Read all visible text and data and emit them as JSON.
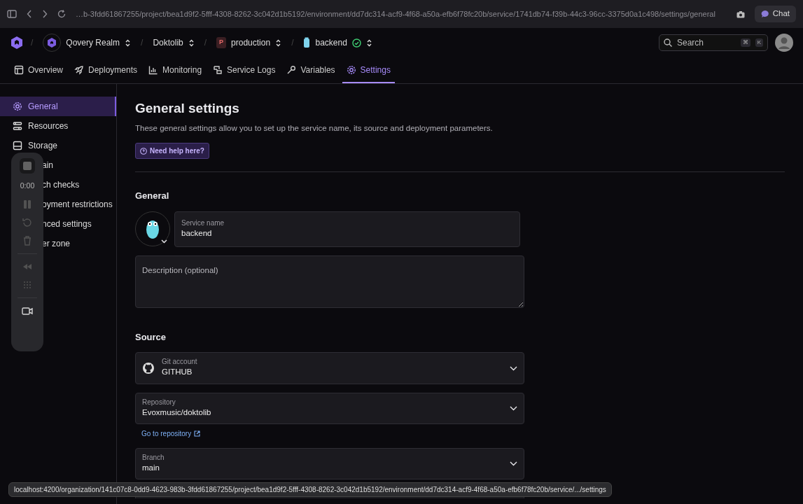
{
  "browser": {
    "url": "…b-3fdd61867255/project/bea1d9f2-5fff-4308-8262-3c042d1b5192/environment/dd7dc314-acf9-4f68-a50a-efb6f78fc20b/service/1741db74-f39b-44c3-96cc-3375d0a1c498/settings/general",
    "chat": "Chat"
  },
  "breadcrumbs": [
    {
      "kind": "org",
      "separator": "/",
      "label": "Qovery Realm"
    },
    {
      "kind": "project",
      "separator": "/",
      "label": "Doktolib"
    },
    {
      "kind": "environment",
      "separator": "/",
      "badge": "P",
      "label": "production"
    },
    {
      "kind": "service",
      "separator": "/",
      "label": "backend",
      "healthy": true
    }
  ],
  "search": {
    "placeholder": "Search",
    "keys": [
      "⌘",
      "K"
    ]
  },
  "tabs": [
    {
      "label": "Overview",
      "selected": false
    },
    {
      "label": "Deployments",
      "selected": false
    },
    {
      "label": "Monitoring",
      "selected": false
    },
    {
      "label": "Service Logs",
      "selected": false
    },
    {
      "label": "Variables",
      "selected": false
    },
    {
      "label": "Settings",
      "selected": true
    }
  ],
  "sidebar": {
    "items": [
      {
        "label": "General",
        "selected": true
      },
      {
        "label": "Resources",
        "selected": false
      },
      {
        "label": "Storage",
        "selected": false
      },
      {
        "label": "ain",
        "selected": false
      },
      {
        "label": "ch checks",
        "selected": false
      },
      {
        "label": "oyment restrictions",
        "selected": false
      },
      {
        "label": "nced settings",
        "selected": false
      },
      {
        "label": "er zone",
        "selected": false
      }
    ]
  },
  "page": {
    "title": "General settings",
    "description": "These general settings allow you to set up the service name, its source and deployment parameters.",
    "help": "Need help here?",
    "general": {
      "title": "General",
      "service_name": {
        "label": "Service name",
        "value": "backend"
      },
      "description_field": {
        "placeholder": "Description (optional)"
      }
    },
    "source": {
      "title": "Source",
      "fields": [
        {
          "kind": "select",
          "label": "Git account",
          "value": "GITHUB"
        },
        {
          "kind": "select",
          "label": "Repository",
          "value": "Evoxmusic/doktolib",
          "link": "Go to repository"
        },
        {
          "kind": "select",
          "label": "Branch",
          "value": "main"
        },
        {
          "kind": "covered"
        }
      ]
    }
  },
  "recorder": {
    "time": "0:00"
  },
  "status_url": "localhost:4200/organization/141c07c8-0dd9-4623-983b-3fdd61867255/project/bea1d9f2-5fff-4308-8262-3c042d1b5192/environment/dd7dc314-acf9-4f68-a50a-efb6f78fc20b/service/.../settings"
}
